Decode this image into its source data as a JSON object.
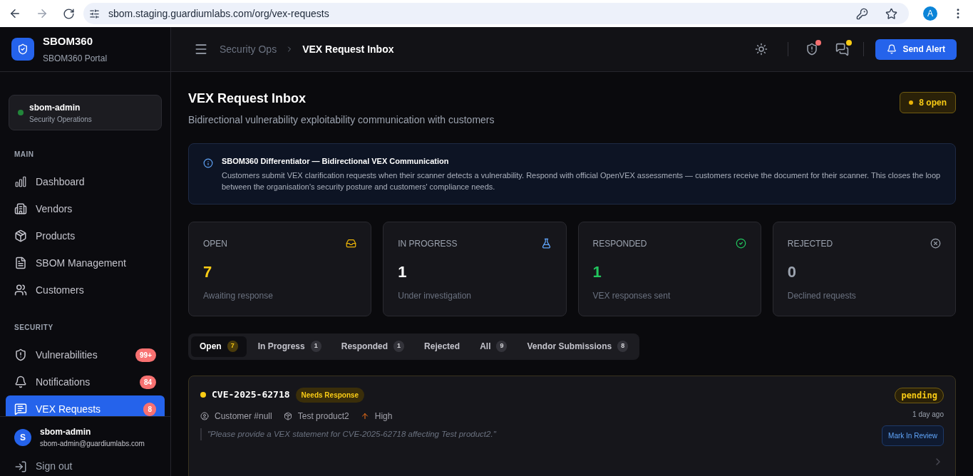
{
  "browser": {
    "url": "sbom.staging.guardiumlabs.com/org/vex-requests",
    "profile": "A"
  },
  "brand": {
    "name": "SBOM360",
    "subtitle": "SBOM360 Portal"
  },
  "org": {
    "name": "sbom-admin",
    "role": "Security Operations",
    "color": "#22863a"
  },
  "sidebar": {
    "sections": [
      {
        "title": "MAIN",
        "items": [
          {
            "label": "Dashboard",
            "selected": false
          },
          {
            "label": "Vendors",
            "selected": false
          },
          {
            "label": "Products",
            "selected": false
          },
          {
            "label": "SBOM Management",
            "selected": false
          },
          {
            "label": "Customers",
            "selected": false
          }
        ]
      },
      {
        "title": "SECURITY",
        "items": [
          {
            "label": "Vulnerabilities",
            "badge": "99+",
            "selected": false
          },
          {
            "label": "Notifications",
            "badge": "84",
            "selected": false
          },
          {
            "label": "VEX Requests",
            "badge": "8",
            "selected": true
          }
        ]
      }
    ]
  },
  "user": {
    "initial": "S",
    "name": "sbom-admin",
    "email": "sbom-admin@guardiumlabs.com",
    "sign_out": "Sign out"
  },
  "header": {
    "breadcrumb": [
      "Security Ops",
      "VEX Request Inbox"
    ],
    "send_alert": "Send Alert"
  },
  "page": {
    "title": "VEX Request Inbox",
    "subtitle": "Bidirectional vulnerability exploitability communication with customers",
    "open_badge": "8 open"
  },
  "info": {
    "title": "SBOM360 Differentiator — Bidirectional VEX Communication",
    "body": "Customers submit VEX clarification requests when their scanner detects a vulnerability. Respond with official OpenVEX assessments — customers receive the document for their scanner. This closes the loop between the organisation's security posture and customers' compliance needs."
  },
  "stats": [
    {
      "label": "OPEN",
      "value": "7",
      "caption": "Awaiting response",
      "color": "#facc15"
    },
    {
      "label": "IN PROGRESS",
      "value": "1",
      "caption": "Under investigation",
      "color": "#ffffff"
    },
    {
      "label": "RESPONDED",
      "value": "1",
      "caption": "VEX responses sent",
      "color": "#22c55e"
    },
    {
      "label": "REJECTED",
      "value": "0",
      "caption": "Declined requests",
      "color": "#9ca3af"
    }
  ],
  "tabs": [
    {
      "label": "Open",
      "count": "7",
      "selected": true
    },
    {
      "label": "In Progress",
      "count": "1",
      "selected": false
    },
    {
      "label": "Responded",
      "count": "1",
      "selected": false
    },
    {
      "label": "Rejected",
      "selected": false
    },
    {
      "label": "All",
      "count": "9",
      "selected": false
    },
    {
      "label": "Vendor Submissions",
      "count": "8",
      "selected": false
    }
  ],
  "requests": [
    {
      "cve": "CVE-2025-62718",
      "tag": "Needs Response",
      "customer": "Customer #null",
      "product": "Test product2",
      "severity": "High",
      "message": "\"Please provide a VEX statement for CVE-2025-62718 affecting Test product2.\"",
      "status": "pending",
      "age": "1 day ago",
      "action": "Mark In Review",
      "color": "#facc15"
    }
  ]
}
